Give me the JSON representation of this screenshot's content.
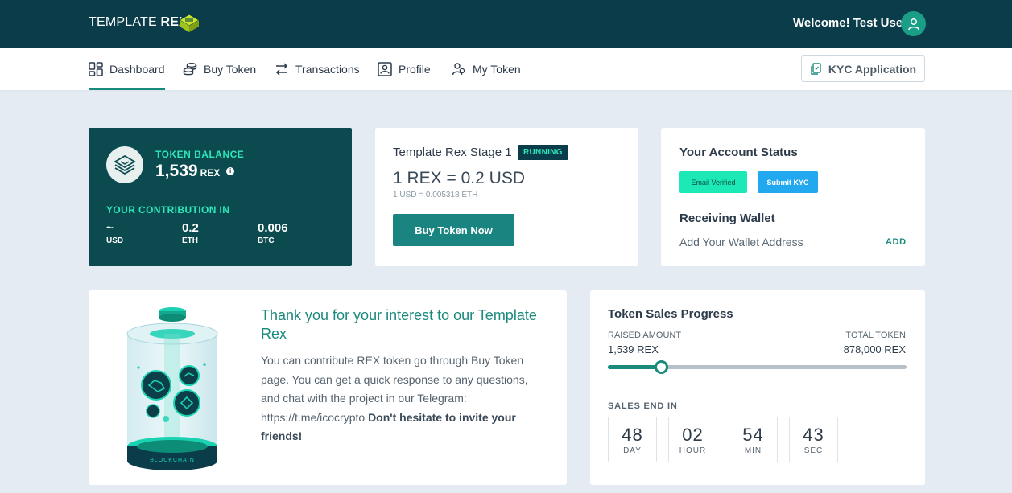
{
  "brand": {
    "name_light": "TEMPLATE",
    "name_bold": "REX"
  },
  "header": {
    "welcome": "Welcome! Test User"
  },
  "nav": {
    "items": [
      {
        "label": "Dashboard",
        "icon": "dashboard-icon",
        "active": true
      },
      {
        "label": "Buy Token",
        "icon": "coins-icon"
      },
      {
        "label": "Transactions",
        "icon": "transfer-icon"
      },
      {
        "label": "Profile",
        "icon": "profile-icon"
      },
      {
        "label": "My Token",
        "icon": "users-icon"
      }
    ],
    "kyc_button": "KYC Application"
  },
  "balance": {
    "label": "TOKEN BALANCE",
    "value": "1,539",
    "unit": "REX",
    "contribution_label": "YOUR CONTRIBUTION IN",
    "contributions": [
      {
        "value": "~",
        "unit": "USD"
      },
      {
        "value": "0.2",
        "unit": "ETH"
      },
      {
        "value": "0.006",
        "unit": "BTC"
      }
    ]
  },
  "stage": {
    "title": "Template Rex Stage 1",
    "badge": "RUNNING",
    "rate": "1 REX = 0.2 USD",
    "rate_sub": "1 USD = 0.005318 ETH",
    "buy_button": "Buy Token Now"
  },
  "account": {
    "title": "Your Account Status",
    "email_verified": "Email Verified",
    "submit_kyc": "Submit KYC",
    "wallet_title": "Receiving Wallet",
    "wallet_placeholder": "Add Your Wallet Address",
    "add_label": "ADD"
  },
  "info": {
    "title": "Thank you for your interest to our Template Rex",
    "text": "You can contribute REX token go through Buy Token page. You can get a quick response to any questions, and chat with the project in our Telegram: https://t.me/icocrypto",
    "text_bold": "Don't hesitate to invite your friends!",
    "illustration_caption": "BLOCKCHAIN"
  },
  "progress": {
    "title": "Token Sales Progress",
    "raised_label": "RAISED AMOUNT",
    "raised_value": "1,539 REX",
    "total_label": "TOTAL TOKEN",
    "total_value": "878,000 REX",
    "percent": 0.18,
    "sales_end_label": "SALES END IN",
    "countdown": [
      {
        "value": "48",
        "unit": "DAY"
      },
      {
        "value": "02",
        "unit": "HOUR"
      },
      {
        "value": "54",
        "unit": "MIN"
      },
      {
        "value": "43",
        "unit": "SEC"
      }
    ]
  },
  "colors": {
    "header_bg": "#0b3c49",
    "accent": "#1a8a7c",
    "mint": "#2ee6b9",
    "email_verified_bg": "#1de9b6",
    "submit_kyc_bg": "#22a8ef",
    "page_bg": "#e5ebf3"
  }
}
